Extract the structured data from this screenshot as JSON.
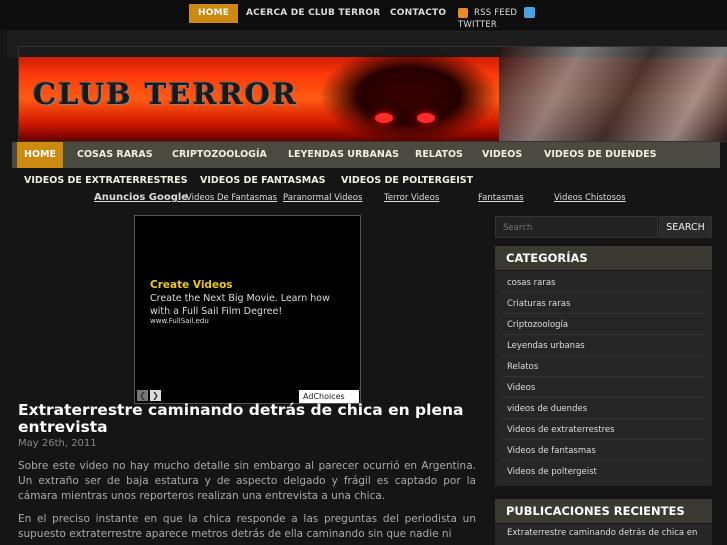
{
  "top_nav": {
    "home": "HOME",
    "about": "ACERCA DE CLUB TERROR",
    "contact": "CONTACTO",
    "rss": "RSS FEED",
    "twitter": "TWITTER"
  },
  "banner": {
    "title": "CLUB TERROR"
  },
  "main_nav": {
    "items": [
      "HOME",
      "COSAS RARAS",
      "CRIPTOZOOLOGÍA",
      "LEYENDAS URBANAS",
      "RELATOS",
      "VIDEOS",
      "VIDEOS DE DUENDES"
    ],
    "row2": [
      "VIDEOS DE EXTRATERRESTRES",
      "VIDEOS DE FANTASMAS",
      "VIDEOS DE POLTERGEIST"
    ]
  },
  "ad_links": {
    "label": "Anuncios Google",
    "links": [
      "Videos De Fantasmas",
      "Paranormal Videos",
      "Terror Videos",
      "Fantasmas",
      "Videos Chistosos"
    ]
  },
  "ad_box": {
    "title": "Create Videos",
    "text": "Create the Next Big Movie. Learn how with a Full Sail Film Degree!",
    "url": "www.FullSail.edu",
    "choices": "AdChoices"
  },
  "post": {
    "title": "Extraterrestre caminando detrás de chica en plena entrevista",
    "date": "May 26th, 2011",
    "paragraphs": [
      "Sobre este video no hay mucho detalle sin embargo al parecer ocurrió en Argentina. Un extraño ser de baja estatura y de aspecto delgado y frágil es captado por la cámara mientras unos reporteros realizan una entrevista a una chica.",
      "En el preciso instante en que la chica responde a las preguntas del periodista un supuesto extraterrestre aparece metros detrás de ella caminando sin que nadie ni"
    ]
  },
  "sidebar": {
    "search_placeholder": "Search",
    "search_button": "SEARCH",
    "categories_title": "CATEGORÍAS",
    "categories": [
      "cosas raras",
      "Criaturas raras",
      "Criptozoología",
      "Leyendas urbanas",
      "Relatos",
      "Videos",
      "videos de duendes",
      "Videos de extraterrestres",
      "Videos de fantasmas",
      "Videos de poltergeist"
    ],
    "recent_title": "PUBLICACIONES RECIENTES",
    "recent": [
      "Extraterrestre caminando detrás de chica en"
    ]
  }
}
